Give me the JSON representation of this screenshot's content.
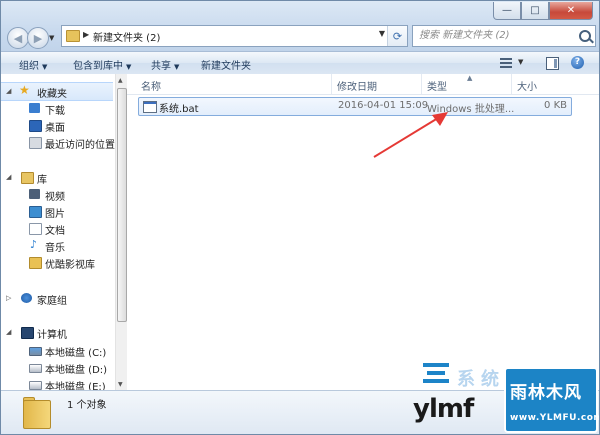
{
  "window": {
    "minimize_glyph": "—",
    "maximize_glyph": "□",
    "close_glyph": "✕"
  },
  "address": {
    "path": "新建文件夹 (2)",
    "search_placeholder": "搜索 新建文件夹 (2)"
  },
  "toolbar": {
    "organize": "组织",
    "include_in_library": "包含到库中",
    "share": "共享",
    "new_folder": "新建文件夹"
  },
  "sidebar": {
    "favorites": {
      "label": "收藏夹",
      "items": [
        "下载",
        "桌面",
        "最近访问的位置"
      ]
    },
    "libraries": {
      "label": "库",
      "items": [
        "视频",
        "图片",
        "文档",
        "音乐",
        "优酷影视库"
      ]
    },
    "homegroup": "家庭组",
    "computer": {
      "label": "计算机",
      "items": [
        "本地磁盘 (C:)",
        "本地磁盘 (D:)",
        "本地磁盘 (E:)"
      ]
    }
  },
  "columns": {
    "name": "名称",
    "modified": "修改日期",
    "type": "类型",
    "size": "大小"
  },
  "files": [
    {
      "name": "系统.bat",
      "modified": "2016-04-01 15:09",
      "type": "Windows 批处理...",
      "size": "0 KB"
    }
  ],
  "status": {
    "count": "1 个对象"
  },
  "watermark": {
    "brand": "ylmf",
    "faded": "系统之家",
    "badge_title": "雨林木风",
    "badge_url": "www.YLMFU.com"
  },
  "colors": {
    "accent": "#1c84c6",
    "arrow": "#e53935",
    "selection_border": "#84acdd"
  }
}
